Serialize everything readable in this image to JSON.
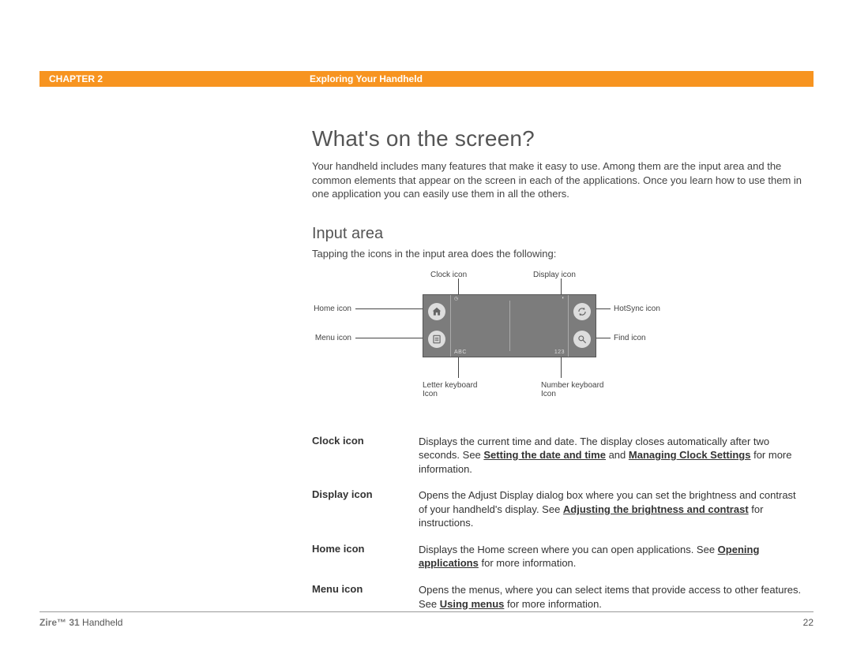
{
  "header": {
    "chapter": "CHAPTER 2",
    "title": "Exploring Your Handheld"
  },
  "main": {
    "heading": "What's on the screen?",
    "intro": "Your handheld includes many features that make it easy to use. Among them are the input area and the common elements that appear on the screen in each of the applications. Once you learn how to use them in one application you can easily use them in all the others.",
    "section_heading": "Input area",
    "section_sub": "Tapping the icons in the input area does the following:"
  },
  "diagram": {
    "labels": {
      "clock": "Clock icon",
      "display": "Display icon",
      "home": "Home icon",
      "hotsync": "HotSync icon",
      "menu": "Menu icon",
      "find": "Find icon",
      "letter_kb_l1": "Letter keyboard",
      "letter_kb_l2": "Icon",
      "number_kb_l1": "Number keyboard",
      "number_kb_l2": "Icon"
    },
    "inside": {
      "abc": "ABC",
      "num": "123"
    }
  },
  "defs": [
    {
      "term": "Clock icon",
      "pre": "Displays the current time and date. The display closes automatically after two seconds. See ",
      "link1": "Setting the date and time",
      "mid": " and ",
      "link2": "Managing Clock Settings",
      "post": " for more information."
    },
    {
      "term": "Display icon",
      "pre": "Opens the Adjust Display dialog box where you can set the brightness and contrast of your handheld's display. See ",
      "link1": "Adjusting the brightness and contrast",
      "mid": "",
      "link2": "",
      "post": " for instructions."
    },
    {
      "term": "Home icon",
      "pre": "Displays the Home screen where you can open applications. See ",
      "link1": "Opening applications",
      "mid": "",
      "link2": "",
      "post": " for more information."
    },
    {
      "term": "Menu icon",
      "pre": "Opens the menus, where you can select items that provide access to other features. See ",
      "link1": "Using menus",
      "mid": "",
      "link2": "",
      "post": " for more information."
    }
  ],
  "footer": {
    "product_bold": "Zire™ 31",
    "product_rest": " Handheld",
    "page": "22"
  }
}
